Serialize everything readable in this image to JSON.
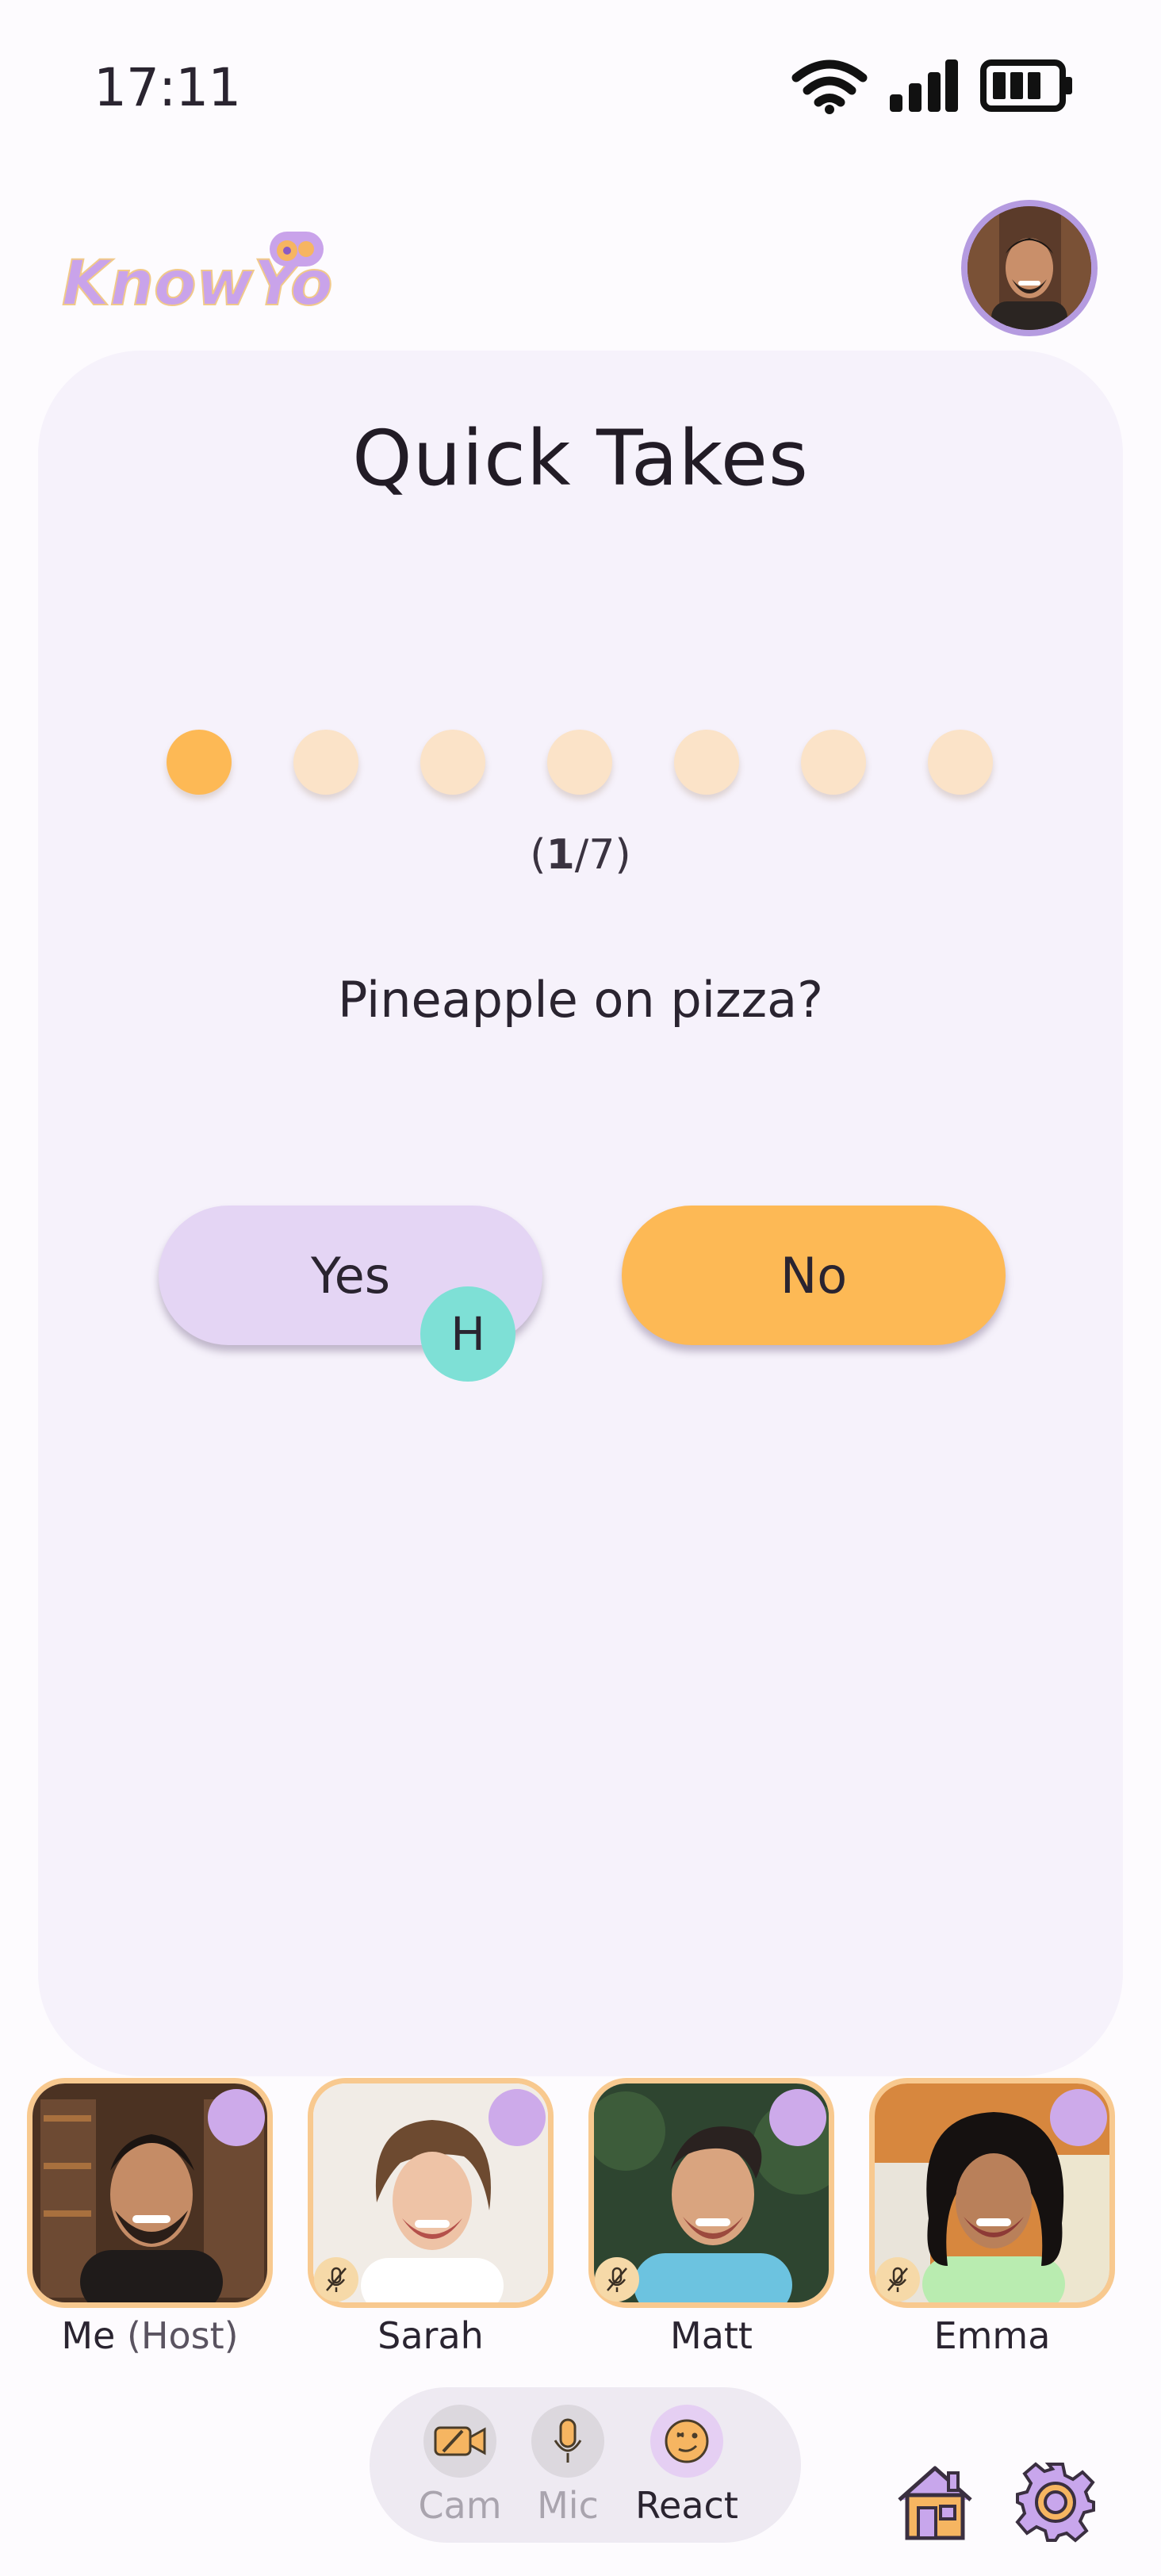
{
  "status_bar": {
    "time": "17:11"
  },
  "app": {
    "logo_text": "KnowYou"
  },
  "quiz": {
    "title": "Quick Takes",
    "progress": {
      "current": "1",
      "separator": "/",
      "total": "7",
      "open": "(",
      "close": ")"
    },
    "question": "Pineapple on pizza?",
    "answers": {
      "yes": "Yes",
      "no": "No"
    },
    "voter_initial": "H"
  },
  "participants": [
    {
      "name": "Me",
      "suffix": "(Host)"
    },
    {
      "name": "Sarah",
      "suffix": ""
    },
    {
      "name": "Matt",
      "suffix": ""
    },
    {
      "name": "Emma",
      "suffix": ""
    }
  ],
  "controls": {
    "cam": "Cam",
    "mic": "Mic",
    "react": "React"
  },
  "colors": {
    "accent_orange": "#fdb955",
    "accent_purple": "#b59be0",
    "voter_teal": "#7ee0d6",
    "card_bg": "#f6f2fb"
  },
  "icons": [
    "wifi-icon",
    "signal-icon",
    "battery-icon",
    "home-icon",
    "settings-gear-icon",
    "camera-off-icon",
    "microphone-icon",
    "react-emoji-icon"
  ]
}
